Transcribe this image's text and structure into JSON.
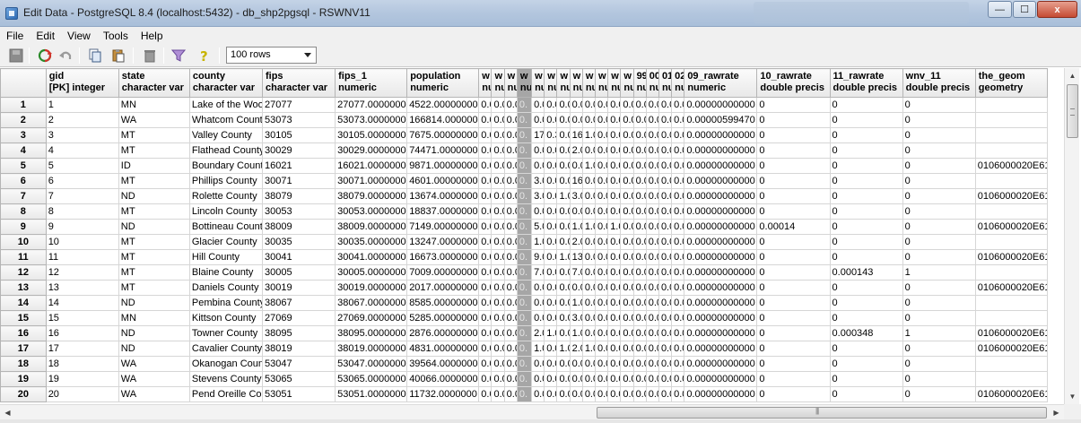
{
  "window": {
    "title": "Edit Data - PostgreSQL 8.4 (localhost:5432) - db_shp2pgsql - RSWNV11",
    "minimize_label": "—",
    "maximize_label": "☐",
    "close_label": "x"
  },
  "menu": [
    {
      "label": "File"
    },
    {
      "label": "Edit"
    },
    {
      "label": "View"
    },
    {
      "label": "Tools"
    },
    {
      "label": "Help"
    }
  ],
  "toolbar": {
    "row_limit": "100 rows",
    "icons": [
      "save-icon",
      "refresh-icon",
      "undo-icon",
      "copy-icon",
      "paste-icon",
      "delete-icon",
      "filter-icon",
      "help-icon"
    ]
  },
  "columns": [
    {
      "name": "",
      "type": ""
    },
    {
      "name": "gid",
      "type": "[PK] integer"
    },
    {
      "name": "state",
      "type": "character var"
    },
    {
      "name": "county",
      "type": "character var"
    },
    {
      "name": "fips",
      "type": "character var"
    },
    {
      "name": "fips_1",
      "type": "numeric"
    },
    {
      "name": "population",
      "type": "numeric"
    },
    {
      "name": "w",
      "type": "nu"
    },
    {
      "name": "w",
      "type": "nu"
    },
    {
      "name": "w",
      "type": "nu"
    },
    {
      "name": "w",
      "type": "nu"
    },
    {
      "name": "w",
      "type": "nu"
    },
    {
      "name": "w",
      "type": "nu"
    },
    {
      "name": "w",
      "type": "nu"
    },
    {
      "name": "w",
      "type": "nu"
    },
    {
      "name": "w",
      "type": "nu"
    },
    {
      "name": "w",
      "type": "nu"
    },
    {
      "name": "w",
      "type": "nu"
    },
    {
      "name": "w",
      "type": "nu"
    },
    {
      "name": "99",
      "type": "nu"
    },
    {
      "name": "00",
      "type": "nu"
    },
    {
      "name": "01",
      "type": "nu"
    },
    {
      "name": "02",
      "type": "nu"
    },
    {
      "name": "09_rawrate",
      "type": "numeric"
    },
    {
      "name": "10_rawrate",
      "type": "double precis"
    },
    {
      "name": "11_rawrate",
      "type": "double precis"
    },
    {
      "name": "wnv_11",
      "type": "double precis"
    },
    {
      "name": "the_geom",
      "type": "geometry"
    }
  ],
  "rows": [
    [
      "1",
      "1",
      "MN",
      "Lake of the Woo",
      "27077",
      "27077.0000000",
      "4522.00000000",
      "0.0",
      "0.0",
      "0.0",
      "0.",
      "0.0",
      "0.0",
      "0.0",
      "0.0",
      "0.0",
      "0.0",
      "0.0",
      "0.0",
      "0.0",
      "0.0",
      "0.0",
      "0.0",
      "0.00000000000",
      "0",
      "0",
      "0",
      ""
    ],
    [
      "2",
      "2",
      "WA",
      "Whatcom Count",
      "53073",
      "53073.0000000",
      "166814.0000000",
      "0.0",
      "0.0",
      "0.0",
      "0.",
      "0.0",
      "0.0",
      "0.0",
      "0.0",
      "0.0",
      "0.0",
      "0.0",
      "0.0",
      "0.0",
      "0.0",
      "0.0",
      "0.0",
      "0.00000599470",
      "0",
      "0",
      "0",
      ""
    ],
    [
      "3",
      "3",
      "MT",
      "Valley County",
      "30105",
      "30105.0000000",
      "7675.00000000",
      "0.0",
      "0.0",
      "0.0",
      "0.",
      "17",
      "0.3",
      "0.0",
      "16",
      "1.0",
      "0.0",
      "0.0",
      "0.0",
      "0.0",
      "0.0",
      "0.0",
      "0.0",
      "0.00000000000",
      "0",
      "0",
      "0",
      ""
    ],
    [
      "4",
      "4",
      "MT",
      "Flathead County",
      "30029",
      "30029.0000000",
      "74471.0000000",
      "0.0",
      "0.0",
      "0.0",
      "0.",
      "0.0",
      "0.0",
      "0.0",
      "2.0",
      "0.0",
      "0.0",
      "0.0",
      "0.0",
      "0.0",
      "0.0",
      "0.0",
      "0.0",
      "0.00000000000",
      "0",
      "0",
      "0",
      ""
    ],
    [
      "5",
      "5",
      "ID",
      "Boundary Count",
      "16021",
      "16021.0000000",
      "9871.00000000",
      "0.0",
      "0.0",
      "0.0",
      "0.",
      "0.0",
      "0.0",
      "0.0",
      "0.0",
      "1.0",
      "0.0",
      "0.0",
      "0.0",
      "0.0",
      "0.0",
      "0.0",
      "0.0",
      "0.00000000000",
      "0",
      "0",
      "0",
      "0106000020E61"
    ],
    [
      "6",
      "6",
      "MT",
      "Phillips County",
      "30071",
      "30071.0000000",
      "4601.00000000",
      "0.0",
      "0.0",
      "0.0",
      "0.",
      "3.0",
      "0.0",
      "0.0",
      "16",
      "0.0",
      "0.0",
      "0.0",
      "0.0",
      "0.0",
      "0.0",
      "0.0",
      "0.0",
      "0.00000000000",
      "0",
      "0",
      "0",
      ""
    ],
    [
      "7",
      "7",
      "ND",
      "Rolette County",
      "38079",
      "38079.0000000",
      "13674.0000000",
      "0.0",
      "0.0",
      "0.0",
      "0.",
      "3.0",
      "0.0",
      "1.0",
      "3.0",
      "0.0",
      "0.0",
      "0.0",
      "0.0",
      "0.0",
      "0.0",
      "0.0",
      "0.0",
      "0.00000000000",
      "0",
      "0",
      "0",
      "0106000020E61"
    ],
    [
      "8",
      "8",
      "MT",
      "Lincoln County",
      "30053",
      "30053.0000000",
      "18837.0000000",
      "0.0",
      "0.0",
      "0.0",
      "0.",
      "0.0",
      "0.0",
      "0.0",
      "0.0",
      "0.0",
      "0.0",
      "0.0",
      "0.0",
      "0.0",
      "0.0",
      "0.0",
      "0.0",
      "0.00000000000",
      "0",
      "0",
      "0",
      ""
    ],
    [
      "9",
      "9",
      "ND",
      "Bottineau Count",
      "38009",
      "38009.0000000",
      "7149.00000000",
      "0.0",
      "0.0",
      "0.0",
      "0.",
      "5.0",
      "0.0",
      "0.0",
      "1.0",
      "1.0",
      "0.0",
      "1.0",
      "0.0",
      "0.0",
      "0.0",
      "0.0",
      "0.0",
      "0.00000000000",
      "0.00014",
      "0",
      "0",
      "0106000020E61"
    ],
    [
      "10",
      "10",
      "MT",
      "Glacier County",
      "30035",
      "30035.0000000",
      "13247.0000000",
      "0.0",
      "0.0",
      "0.0",
      "0.",
      "1.0",
      "0.0",
      "0.0",
      "2.0",
      "0.0",
      "0.0",
      "0.0",
      "0.0",
      "0.0",
      "0.0",
      "0.0",
      "0.0",
      "0.00000000000",
      "0",
      "0",
      "0",
      ""
    ],
    [
      "11",
      "11",
      "MT",
      "Hill County",
      "30041",
      "30041.0000000",
      "16673.0000000",
      "0.0",
      "0.0",
      "0.0",
      "0.",
      "9.0",
      "0.0",
      "1.0",
      "13",
      "0.0",
      "0.0",
      "0.0",
      "0.0",
      "0.0",
      "0.0",
      "0.0",
      "0.0",
      "0.00000000000",
      "0",
      "0",
      "0",
      "0106000020E61"
    ],
    [
      "12",
      "12",
      "MT",
      "Blaine County",
      "30005",
      "30005.0000000",
      "7009.00000000",
      "0.0",
      "0.0",
      "0.0",
      "0.",
      "7.0",
      "0.0",
      "0.0",
      "7.0",
      "0.0",
      "0.0",
      "0.0",
      "0.0",
      "0.0",
      "0.0",
      "0.0",
      "0.0",
      "0.00000000000",
      "0",
      "0.000143",
      "1",
      ""
    ],
    [
      "13",
      "13",
      "MT",
      "Daniels County",
      "30019",
      "30019.0000000",
      "2017.00000000",
      "0.0",
      "0.0",
      "0.0",
      "0.",
      "0.0",
      "0.0",
      "0.0",
      "0.0",
      "0.0",
      "0.0",
      "0.0",
      "0.0",
      "0.0",
      "0.0",
      "0.0",
      "0.0",
      "0.00000000000",
      "0",
      "0",
      "0",
      "0106000020E61"
    ],
    [
      "14",
      "14",
      "ND",
      "Pembina County",
      "38067",
      "38067.0000000",
      "8585.00000000",
      "0.0",
      "0.0",
      "0.0",
      "0.",
      "0.0",
      "0.0",
      "0.0",
      "1.0",
      "0.0",
      "0.0",
      "0.0",
      "0.0",
      "0.0",
      "0.0",
      "0.0",
      "0.0",
      "0.00000000000",
      "0",
      "0",
      "0",
      ""
    ],
    [
      "15",
      "15",
      "MN",
      "Kittson County",
      "27069",
      "27069.0000000",
      "5285.00000000",
      "0.0",
      "0.0",
      "0.0",
      "0.",
      "0.0",
      "0.0",
      "0.0",
      "3.0",
      "0.0",
      "0.0",
      "0.0",
      "0.0",
      "0.0",
      "0.0",
      "0.0",
      "0.0",
      "0.00000000000",
      "0",
      "0",
      "0",
      ""
    ],
    [
      "16",
      "16",
      "ND",
      "Towner County",
      "38095",
      "38095.0000000",
      "2876.00000000",
      "0.0",
      "0.0",
      "0.0",
      "0.",
      "2.0",
      "1.0",
      "0.0",
      "1.0",
      "0.0",
      "0.0",
      "0.0",
      "0.0",
      "0.0",
      "0.0",
      "0.0",
      "0.0",
      "0.00000000000",
      "0",
      "0.000348",
      "1",
      "0106000020E61"
    ],
    [
      "17",
      "17",
      "ND",
      "Cavalier County",
      "38019",
      "38019.0000000",
      "4831.00000000",
      "0.0",
      "0.0",
      "0.0",
      "0.",
      "1.0",
      "0.0",
      "1.0",
      "2.0",
      "1.0",
      "0.0",
      "0.0",
      "0.0",
      "0.0",
      "0.0",
      "0.0",
      "0.0",
      "0.00000000000",
      "0",
      "0",
      "0",
      "0106000020E61"
    ],
    [
      "18",
      "18",
      "WA",
      "Okanogan Coun",
      "53047",
      "53047.0000000",
      "39564.0000000",
      "0.0",
      "0.0",
      "0.0",
      "0.",
      "0.0",
      "0.0",
      "0.0",
      "0.0",
      "0.0",
      "0.0",
      "0.0",
      "0.0",
      "0.0",
      "0.0",
      "0.0",
      "0.0",
      "0.00000000000",
      "0",
      "0",
      "0",
      ""
    ],
    [
      "19",
      "19",
      "WA",
      "Stevens County",
      "53065",
      "53065.0000000",
      "40066.0000000",
      "0.0",
      "0.0",
      "0.0",
      "0.",
      "0.0",
      "0.0",
      "0.0",
      "0.0",
      "0.0",
      "0.0",
      "0.0",
      "0.0",
      "0.0",
      "0.0",
      "0.0",
      "0.0",
      "0.00000000000",
      "0",
      "0",
      "0",
      ""
    ],
    [
      "20",
      "20",
      "WA",
      "Pend Oreille Cou",
      "53051",
      "53051.0000000",
      "11732.0000000",
      "0.0",
      "0.0",
      "0.0",
      "0.",
      "0.0",
      "0.0",
      "0.0",
      "0.0",
      "0.0",
      "0.0",
      "0.0",
      "0.0",
      "0.0",
      "0.0",
      "0.0",
      "0.0",
      "0.00000000000",
      "0",
      "0",
      "0",
      "0106000020E61"
    ]
  ],
  "colors": {
    "titlebar": "#b3c6de",
    "header_bg": "#e8e8e8",
    "selected_column": "#a6a6a6"
  }
}
